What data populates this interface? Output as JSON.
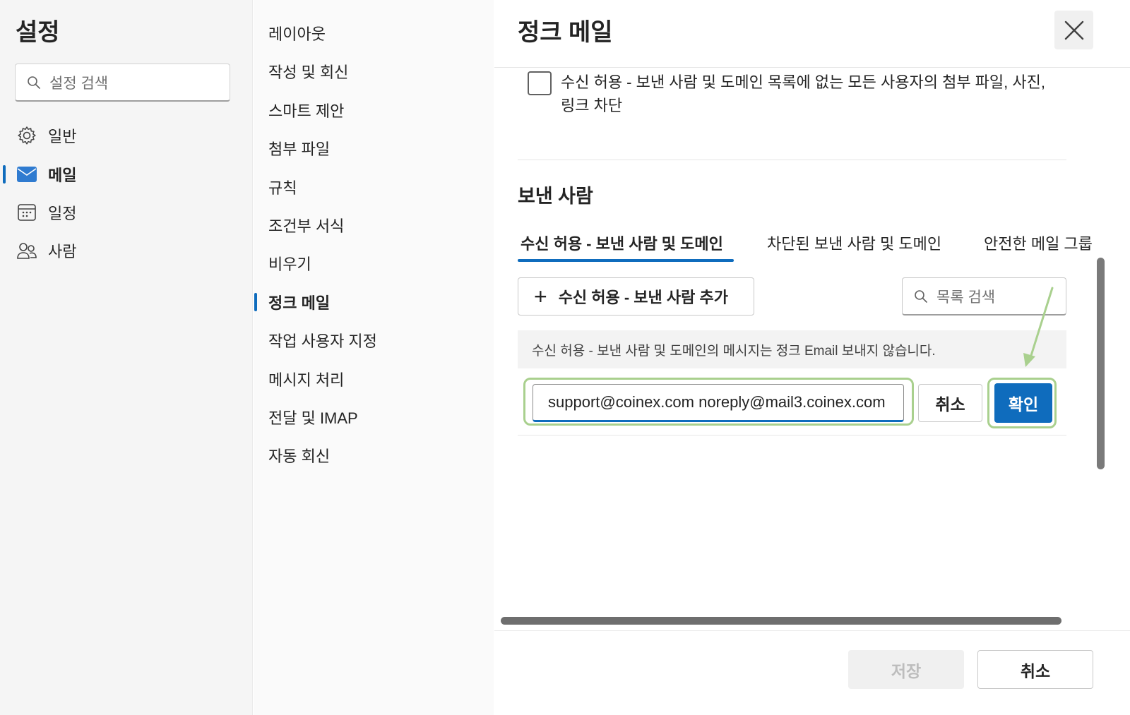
{
  "nav": {
    "title": "설정",
    "search_placeholder": "설정 검색",
    "items": [
      {
        "label": "일반",
        "icon": "gear-icon"
      },
      {
        "label": "메일",
        "icon": "mail-icon",
        "active": true
      },
      {
        "label": "일정",
        "icon": "calendar-icon"
      },
      {
        "label": "사람",
        "icon": "people-icon"
      }
    ]
  },
  "submenu": {
    "items": [
      "레이아웃",
      "작성 및 회신",
      "스마트 제안",
      "첨부 파일",
      "규칙",
      "조건부 서식",
      "비우기",
      "정크 메일",
      "작업 사용자 지정",
      "메시지 처리",
      "전달 및 IMAP",
      "자동 회신"
    ],
    "active": "정크 메일"
  },
  "pane": {
    "title": "정크 메일",
    "checkbox_label": "수신 허용 - 보낸 사람 및 도메인 목록에 없는 모든 사용자의 첨부 파일, 사진, 링크 차단",
    "checkbox_checked": false,
    "section_title": "보낸 사람",
    "tabs": [
      "수신 허용 - 보낸 사람 및 도메인",
      "차단된 보낸 사람 및 도메인",
      "안전한 메일 그룹"
    ],
    "add_button": "수신 허용 - 보낸 사람 추가",
    "list_search_placeholder": "목록 검색",
    "info_text": "수신 허용 - 보낸 사람 및 도메인의 메시지는 정크 Email 보내지 않습니다.",
    "input_value": "support@coinex.com noreply@mail3.coinex.com",
    "inline_cancel": "취소",
    "confirm": "확인",
    "save": "저장",
    "cancel": "취소"
  },
  "colors": {
    "accent": "#0f6cbd",
    "highlight": "#a9d08e"
  }
}
